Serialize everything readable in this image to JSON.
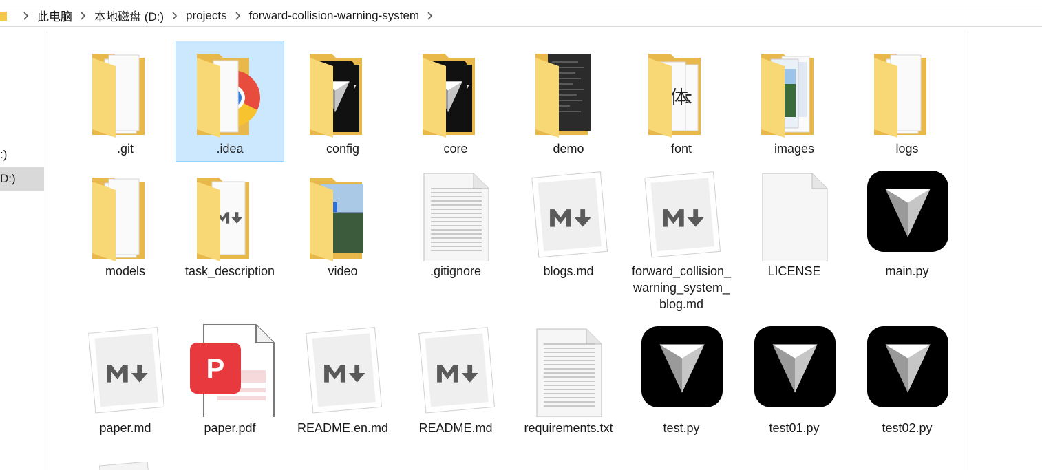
{
  "address": {
    "crumbs": [
      "此电脑",
      "本地磁盘 (D:)",
      "projects",
      "forward-collision-warning-system"
    ]
  },
  "nav": {
    "items": [
      {
        "label": ":)"
      },
      {
        "label": "D:)"
      }
    ]
  },
  "files": [
    {
      "name": ".git",
      "icon": "folder-icon"
    },
    {
      "name": ".idea",
      "icon": "folder-chrome-icon"
    },
    {
      "name": "config",
      "icon": "folder-app-icon"
    },
    {
      "name": "core",
      "icon": "folder-app-icon"
    },
    {
      "name": "demo",
      "icon": "folder-code-icon"
    },
    {
      "name": "font",
      "icon": "folder-font-icon"
    },
    {
      "name": "images",
      "icon": "folder-images-icon"
    },
    {
      "name": "logs",
      "icon": "folder-icon"
    },
    {
      "name": "models",
      "icon": "folder-icon"
    },
    {
      "name": "task_description",
      "icon": "folder-markdown-icon"
    },
    {
      "name": "video",
      "icon": "folder-video-icon"
    },
    {
      "name": ".gitignore",
      "icon": "text-file-icon"
    },
    {
      "name": "blogs.md",
      "icon": "markdown-file-icon"
    },
    {
      "name": "forward_collision_warning_system_blog.md",
      "icon": "markdown-file-icon"
    },
    {
      "name": "LICENSE",
      "icon": "blank-file-icon"
    },
    {
      "name": "main.py",
      "icon": "python-app-icon"
    },
    {
      "name": "paper.md",
      "icon": "markdown-file-icon"
    },
    {
      "name": "paper.pdf",
      "icon": "pdf-file-icon"
    },
    {
      "name": "README.en.md",
      "icon": "markdown-file-icon"
    },
    {
      "name": "README.md",
      "icon": "markdown-file-icon"
    },
    {
      "name": "requirements.txt",
      "icon": "text-file-icon"
    },
    {
      "name": "test.py",
      "icon": "python-app-icon"
    },
    {
      "name": "test01.py",
      "icon": "python-app-icon"
    },
    {
      "name": "test02.py",
      "icon": "python-app-icon"
    }
  ],
  "colors": {
    "folder": "#f8d775",
    "folder_dark": "#e8b84a",
    "selection_bg": "#cce8ff",
    "selection_border": "#99d1ff",
    "pdf_red": "#e8393f"
  }
}
